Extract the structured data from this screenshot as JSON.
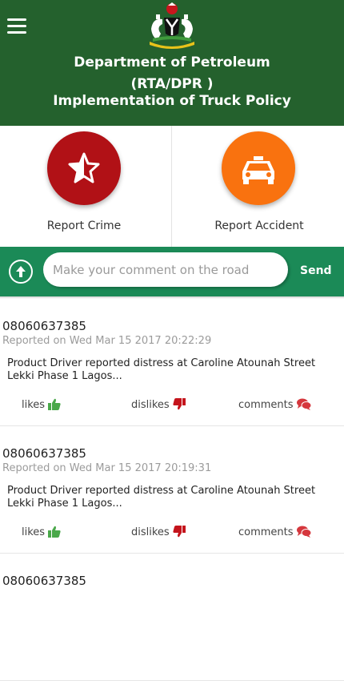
{
  "header": {
    "line1": "Department of Petroleum",
    "line2": "(RTA/DPR )",
    "line3": "Implementation of Truck Policy"
  },
  "icons": {
    "menu": "hamburger-menu-icon",
    "crest": "coat-of-arms-icon",
    "crime": "star-half-icon",
    "accident": "taxi-icon",
    "scroll_top": "arrow-up-icon",
    "like": "thumbs-up-icon",
    "dislike": "thumbs-down-icon",
    "comment": "comments-icon"
  },
  "colors": {
    "header": "#24612d",
    "crime": "#b11116",
    "accident": "#f9720f",
    "comment_bar": "#1b8a57",
    "like": "#4aa84a",
    "dislike": "#c4141c",
    "comment": "#d5373d"
  },
  "actions": {
    "crime_label": "Report Crime",
    "accident_label": "Report Accident"
  },
  "comment_bar": {
    "placeholder": "Make your comment on the road",
    "send_label": "Send"
  },
  "posts": [
    {
      "phone": "08060637385",
      "date": "Reported on Wed Mar 15 2017 20:22:29",
      "body": "Product Driver reported distress at Caroline Atounah Street Lekki Phase 1 Lagos...",
      "likes_label": "likes",
      "dislikes_label": "dislikes",
      "comments_label": "comments"
    },
    {
      "phone": "08060637385",
      "date": "Reported on Wed Mar 15 2017 20:19:31",
      "body": "Product Driver reported distress at Caroline Atounah Street Lekki Phase 1 Lagos...",
      "likes_label": "likes",
      "dislikes_label": "dislikes",
      "comments_label": "comments"
    },
    {
      "phone": "08060637385"
    }
  ]
}
